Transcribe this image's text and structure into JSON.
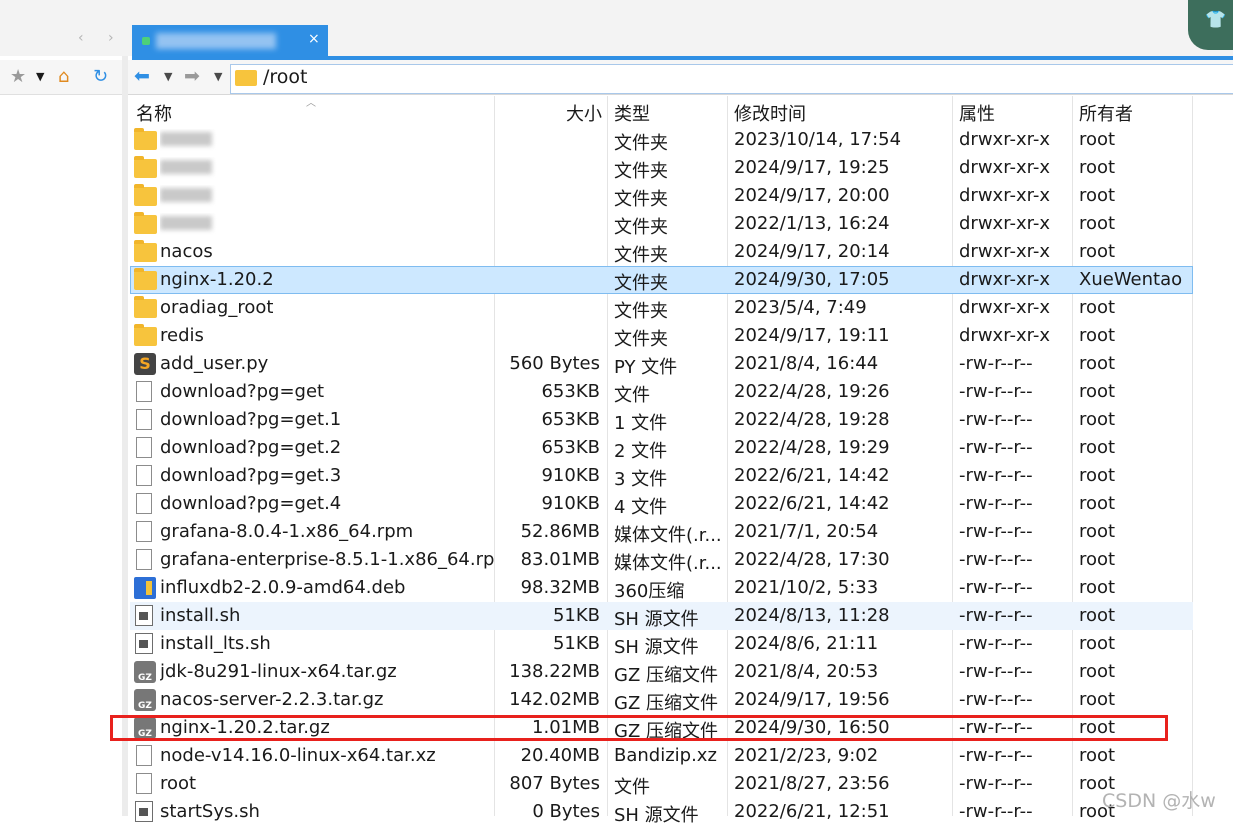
{
  "tab": {
    "label": "",
    "close": "×"
  },
  "nav": {
    "path": "/root"
  },
  "columns": {
    "name": "名称",
    "size": "大小",
    "type": "类型",
    "modified": "修改时间",
    "perm": "属性",
    "owner": "所有者"
  },
  "rows": [
    {
      "name": "",
      "icon": "folder",
      "blur": true,
      "size": "",
      "type": "文件夹",
      "date": "2023/10/14, 17:54",
      "perm": "drwxr-xr-x",
      "owner": "root"
    },
    {
      "name": "",
      "icon": "folder",
      "blur": true,
      "size": "",
      "type": "文件夹",
      "date": "2024/9/17, 19:25",
      "perm": "drwxr-xr-x",
      "owner": "root"
    },
    {
      "name": "",
      "icon": "folder",
      "blur": true,
      "size": "",
      "type": "文件夹",
      "date": "2024/9/17, 20:00",
      "perm": "drwxr-xr-x",
      "owner": "root"
    },
    {
      "name": "",
      "icon": "folder",
      "blur": true,
      "size": "",
      "type": "文件夹",
      "date": "2022/1/13, 16:24",
      "perm": "drwxr-xr-x",
      "owner": "root"
    },
    {
      "name": "nacos",
      "icon": "folder",
      "size": "",
      "type": "文件夹",
      "date": "2024/9/17, 20:14",
      "perm": "drwxr-xr-x",
      "owner": "root"
    },
    {
      "name": "nginx-1.20.2",
      "icon": "folder",
      "size": "",
      "type": "文件夹",
      "date": "2024/9/30, 17:05",
      "perm": "drwxr-xr-x",
      "owner": "XueWentao",
      "selected": true
    },
    {
      "name": "oradiag_root",
      "icon": "folder",
      "size": "",
      "type": "文件夹",
      "date": "2023/5/4, 7:49",
      "perm": "drwxr-xr-x",
      "owner": "root"
    },
    {
      "name": "redis",
      "icon": "folder",
      "size": "",
      "type": "文件夹",
      "date": "2024/9/17, 19:11",
      "perm": "drwxr-xr-x",
      "owner": "root"
    },
    {
      "name": "add_user.py",
      "icon": "py",
      "size": "560 Bytes",
      "type": "PY 文件",
      "date": "2021/8/4, 16:44",
      "perm": "-rw-r--r--",
      "owner": "root"
    },
    {
      "name": "download?pg=get",
      "icon": "file",
      "size": "653KB",
      "type": "文件",
      "date": "2022/4/28, 19:26",
      "perm": "-rw-r--r--",
      "owner": "root"
    },
    {
      "name": "download?pg=get.1",
      "icon": "file",
      "size": "653KB",
      "type": "1 文件",
      "date": "2022/4/28, 19:28",
      "perm": "-rw-r--r--",
      "owner": "root"
    },
    {
      "name": "download?pg=get.2",
      "icon": "file",
      "size": "653KB",
      "type": "2 文件",
      "date": "2022/4/28, 19:29",
      "perm": "-rw-r--r--",
      "owner": "root"
    },
    {
      "name": "download?pg=get.3",
      "icon": "file",
      "size": "910KB",
      "type": "3 文件",
      "date": "2022/6/21, 14:42",
      "perm": "-rw-r--r--",
      "owner": "root"
    },
    {
      "name": "download?pg=get.4",
      "icon": "file",
      "size": "910KB",
      "type": "4 文件",
      "date": "2022/6/21, 14:42",
      "perm": "-rw-r--r--",
      "owner": "root"
    },
    {
      "name": "grafana-8.0.4-1.x86_64.rpm",
      "icon": "file",
      "size": "52.86MB",
      "type": "媒体文件(.r...",
      "date": "2021/7/1, 20:54",
      "perm": "-rw-r--r--",
      "owner": "root"
    },
    {
      "name": "grafana-enterprise-8.5.1-1.x86_64.rp...",
      "icon": "file",
      "size": "83.01MB",
      "type": "媒体文件(.r...",
      "date": "2022/4/28, 17:30",
      "perm": "-rw-r--r--",
      "owner": "root"
    },
    {
      "name": "influxdb2-2.0.9-amd64.deb",
      "icon": "deb",
      "size": "98.32MB",
      "type": "360压缩",
      "date": "2021/10/2, 5:33",
      "perm": "-rw-r--r--",
      "owner": "root"
    },
    {
      "name": "install.sh",
      "icon": "sh",
      "size": "51KB",
      "type": "SH 源文件",
      "date": "2024/8/13, 11:28",
      "perm": "-rw-r--r--",
      "owner": "root",
      "hover": true
    },
    {
      "name": "install_lts.sh",
      "icon": "sh",
      "size": "51KB",
      "type": "SH 源文件",
      "date": "2024/8/6, 21:11",
      "perm": "-rw-r--r--",
      "owner": "root"
    },
    {
      "name": "jdk-8u291-linux-x64.tar.gz",
      "icon": "gz",
      "size": "138.22MB",
      "type": "GZ 压缩文件",
      "date": "2021/8/4, 20:53",
      "perm": "-rw-r--r--",
      "owner": "root"
    },
    {
      "name": "nacos-server-2.2.3.tar.gz",
      "icon": "gz",
      "size": "142.02MB",
      "type": "GZ 压缩文件",
      "date": "2024/9/17, 19:56",
      "perm": "-rw-r--r--",
      "owner": "root"
    },
    {
      "name": "nginx-1.20.2.tar.gz",
      "icon": "gz",
      "size": "1.01MB",
      "type": "GZ 压缩文件",
      "date": "2024/9/30, 16:50",
      "perm": "-rw-r--r--",
      "owner": "root"
    },
    {
      "name": "node-v14.16.0-linux-x64.tar.xz",
      "icon": "file",
      "size": "20.40MB",
      "type": "Bandizip.xz",
      "date": "2021/2/23, 9:02",
      "perm": "-rw-r--r--",
      "owner": "root"
    },
    {
      "name": "root",
      "icon": "file",
      "size": "807 Bytes",
      "type": "文件",
      "date": "2021/8/27, 23:56",
      "perm": "-rw-r--r--",
      "owner": "root"
    },
    {
      "name": "startSys.sh",
      "icon": "sh",
      "size": "0 Bytes",
      "type": "SH 源文件",
      "date": "2022/6/21, 12:51",
      "perm": "-rw-r--r--",
      "owner": "root"
    }
  ],
  "watermark": "CSDN @水w",
  "colors": {
    "accent": "#2f8fe4",
    "selection": "#cde8ff",
    "highlight_box": "#e8211d",
    "folder": "#f7c43d"
  }
}
